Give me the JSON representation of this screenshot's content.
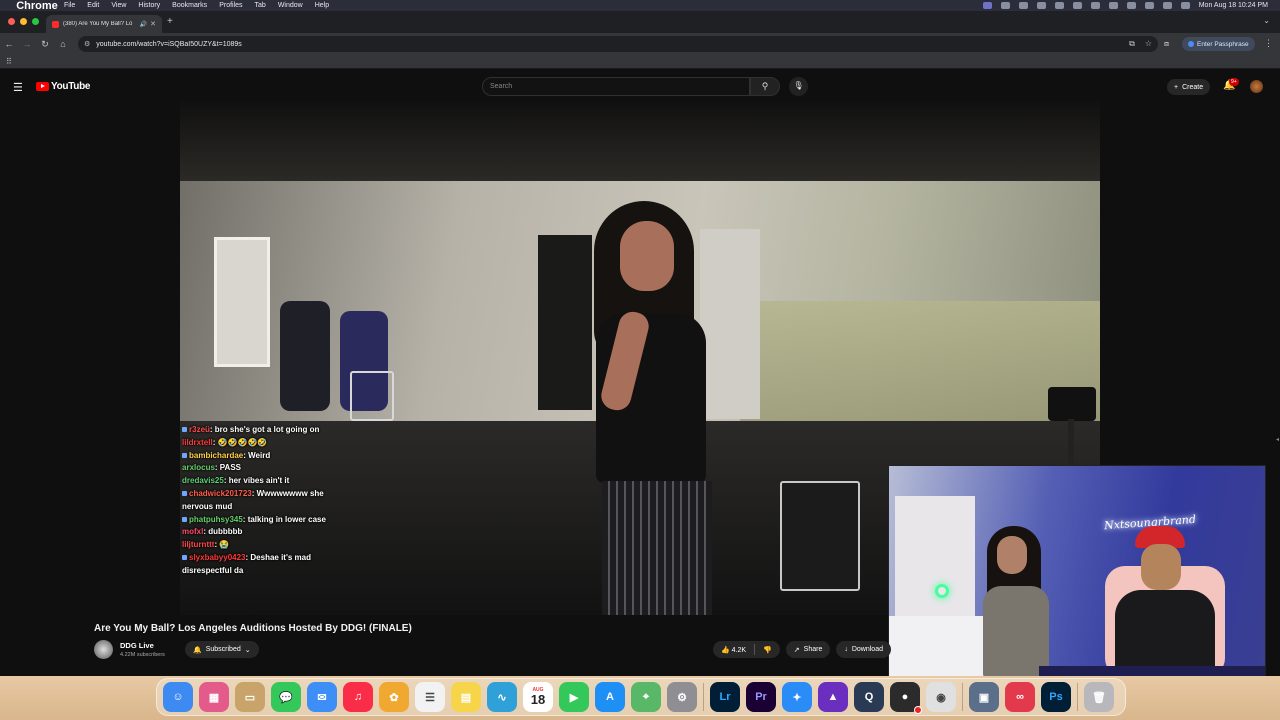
{
  "menubar": {
    "app": "Chrome",
    "items": [
      "File",
      "Edit",
      "View",
      "History",
      "Bookmarks",
      "Profiles",
      "Tab",
      "Window",
      "Help"
    ],
    "clock": "Mon Aug 18  10:24 PM"
  },
  "browser": {
    "tab_title": "(380) Are You My Ball? Lo",
    "url": "youtube.com/watch?v=iSQBaI50UZY&t=1089s",
    "passphrase_label": "Enter Passphrase"
  },
  "youtube": {
    "logo_text": "YouTube",
    "search_placeholder": "Search",
    "create_label": "Create",
    "notif_count": "9+"
  },
  "chat": [
    {
      "user": "r3zeü",
      "color": "#ff4a4a",
      "badge": true,
      "text": "bro she's got a lot going on"
    },
    {
      "user": "lildrxtell",
      "color": "#ff3a3a",
      "badge": false,
      "text": "🤣🤣🤣🤣🤣"
    },
    {
      "user": "bambichardae",
      "color": "#ffd04a",
      "badge": true,
      "text": "Weird"
    },
    {
      "user": "arxlocus",
      "color": "#66d06a",
      "badge": false,
      "text": "PASS"
    },
    {
      "user": "dredavis25",
      "color": "#5cd076",
      "badge": false,
      "text": "her vibes ain't it"
    },
    {
      "user": "chadwick201723",
      "color": "#ff5d4a",
      "badge": true,
      "text": "Wwwwwwww she nervous mud"
    },
    {
      "user": "phatpuhsy345",
      "color": "#66d06a",
      "badge": true,
      "text": "talking in lower case"
    },
    {
      "user": "mofxl",
      "color": "#ff4a6a",
      "badge": false,
      "text": "dubbbbb"
    },
    {
      "user": "liljturnttt",
      "color": "#ff4a4a",
      "badge": false,
      "text": "😭"
    },
    {
      "user": "slyxbabyy0423",
      "color": "#ff3a3a",
      "badge": true,
      "text": "Deshae it's mad disrespectful da"
    }
  ],
  "webcam": {
    "neon_sign": "Nxtsoungrbrand"
  },
  "video": {
    "title": "Are You My Ball? Los Angeles Auditions Hosted By DDG! (FINALE)",
    "channel": "DDG Live",
    "subscribers": "4.22M subscribers",
    "subscribed_label": "Subscribed",
    "likes": "4.2K",
    "share_label": "Share",
    "download_label": "Download"
  },
  "calendar": {
    "month": "AUG",
    "day": "18"
  },
  "dock_apps": [
    {
      "name": "finder",
      "color": "#3d8bf2",
      "glyph": "☺"
    },
    {
      "name": "launchpad",
      "color": "#e35b8a",
      "glyph": "▦"
    },
    {
      "name": "folder",
      "color": "#c8a46a",
      "glyph": "▭"
    },
    {
      "name": "messages",
      "color": "#34c759",
      "glyph": "💬"
    },
    {
      "name": "mail",
      "color": "#3e8ef7",
      "glyph": "✉"
    },
    {
      "name": "music",
      "color": "#fa2d48",
      "glyph": "♫"
    },
    {
      "name": "photos",
      "color": "#f0a830",
      "glyph": "✿"
    },
    {
      "name": "reminders",
      "color": "#f2f2f2",
      "glyph": "☰"
    },
    {
      "name": "notes",
      "color": "#f7d54a",
      "glyph": "▤"
    },
    {
      "name": "freeform",
      "color": "#2fa0d8",
      "glyph": "∿"
    },
    {
      "name": "calendar",
      "color": "#ffffff",
      "glyph": ""
    },
    {
      "name": "facetime",
      "color": "#34c759",
      "glyph": "▶"
    },
    {
      "name": "app-store",
      "color": "#1e8ff5",
      "glyph": "A"
    },
    {
      "name": "maps",
      "color": "#58b868",
      "glyph": "⌖"
    },
    {
      "name": "system-settings",
      "color": "#8e8e93",
      "glyph": "⚙"
    },
    {
      "name": "lightroom",
      "color": "#001e36",
      "glyph": "Lr"
    },
    {
      "name": "premiere",
      "color": "#1a0033",
      "glyph": "Pr"
    },
    {
      "name": "safari",
      "color": "#2a8cf7",
      "glyph": "✦"
    },
    {
      "name": "affinity",
      "color": "#6a2fbf",
      "glyph": "▲"
    },
    {
      "name": "quicktime",
      "color": "#2a3a55",
      "glyph": "Q"
    },
    {
      "name": "obs",
      "color": "#2b2b2b",
      "glyph": "●"
    },
    {
      "name": "chrome",
      "color": "#e0e0e0",
      "glyph": "◉"
    },
    {
      "name": "preview",
      "color": "#5b6e8a",
      "glyph": "▣"
    },
    {
      "name": "creative-cloud",
      "color": "#e3394d",
      "glyph": "∞"
    },
    {
      "name": "photoshop",
      "color": "#001e36",
      "glyph": "Ps"
    },
    {
      "name": "trash",
      "color": "#b8b8bc",
      "glyph": "🗑"
    }
  ]
}
